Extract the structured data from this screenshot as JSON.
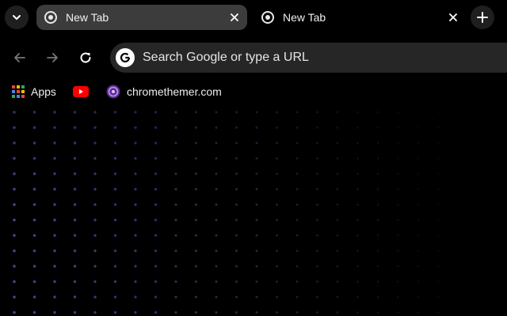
{
  "tabs": [
    {
      "title": "New Tab",
      "active": true,
      "favicon": "chrome-icon"
    },
    {
      "title": "New Tab",
      "active": false,
      "favicon": "chrome-icon"
    }
  ],
  "toolbar": {
    "omnibox_placeholder": "Search Google or type a URL",
    "icons": [
      "back-arrow-icon",
      "forward-arrow-icon",
      "reload-icon",
      "google-g-icon"
    ]
  },
  "bookmarks": [
    {
      "label": "Apps",
      "icon": "apps-grid-icon"
    },
    {
      "label": "",
      "icon": "youtube-icon"
    },
    {
      "label": "chromethemer.com",
      "icon": "chromethemer-icon"
    }
  ],
  "colors": {
    "background": "#000000",
    "active_tab": "#3c3c3c",
    "omnibox": "#262626",
    "dot_color": "#4a4f9a"
  }
}
